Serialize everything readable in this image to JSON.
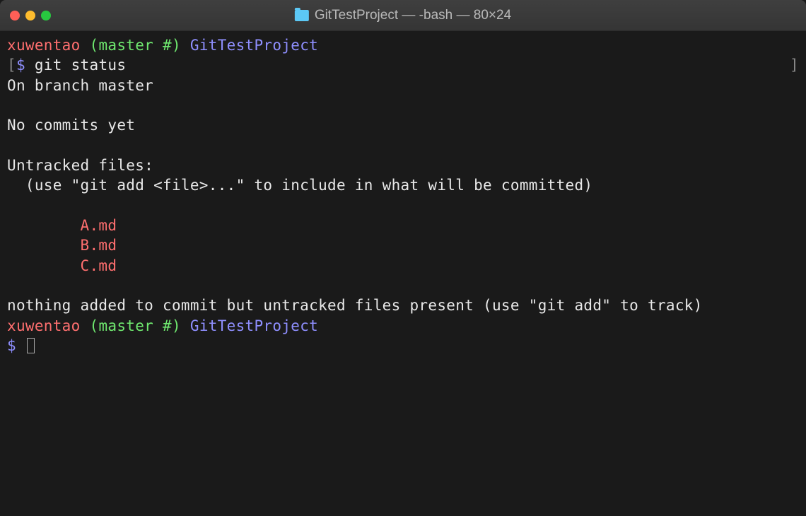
{
  "titlebar": {
    "title": "GitTestProject — -bash — 80×24"
  },
  "prompt1": {
    "user": "xuwentao",
    "branch": "(master #)",
    "path": "GitTestProject",
    "bracket_open": "[",
    "bracket_close": "]",
    "sigil": "$ ",
    "command": "git status"
  },
  "output": {
    "line1": "On branch master",
    "line2": "",
    "line3": "No commits yet",
    "line4": "",
    "line5": "Untracked files:",
    "line6": "  (use \"git add <file>...\" to include in what will be committed)",
    "line7": "",
    "file1": "        A.md",
    "file2": "        B.md",
    "file3": "        C.md",
    "line8": "",
    "line9": "nothing added to commit but untracked files present (use \"git add\" to track)"
  },
  "prompt2": {
    "user": "xuwentao",
    "branch": "(master #)",
    "path": "GitTestProject",
    "sigil": "$ "
  }
}
